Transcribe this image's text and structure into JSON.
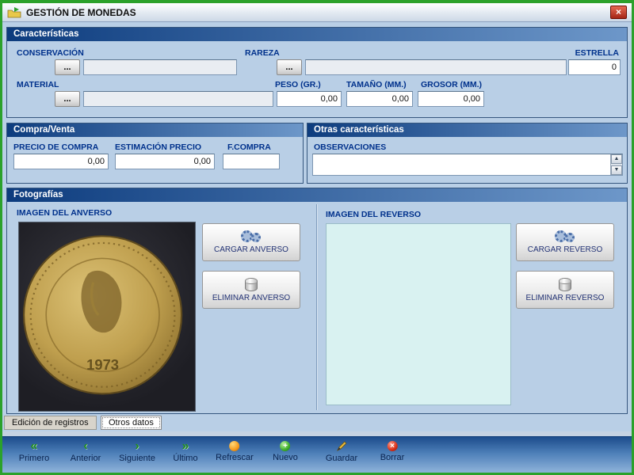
{
  "window": {
    "title": "GESTIÓN DE MONEDAS",
    "close_glyph": "×"
  },
  "icons": {
    "ellipsis": "...",
    "up": "▲",
    "down": "▼"
  },
  "colors": {
    "accent_green": "#2ba12b",
    "header_blue": "#0d3c7e",
    "label_blue": "#00318c",
    "toolbar_blue": "#4d7fb8"
  },
  "caracteristicas": {
    "header": "Características",
    "conservacion_label": "CONSERVACIÓN",
    "conservacion_value": "",
    "rareza_label": "RAREZA",
    "rareza_value": "",
    "estrella_label": "ESTRELLA",
    "estrella_value": "0",
    "material_label": "MATERIAL",
    "material_value": "",
    "peso_label": "PESO (GR.)",
    "peso_value": "0,00",
    "tamano_label": "TAMAÑO (MM.)",
    "tamano_value": "0,00",
    "grosor_label": "GROSOR (MM.)",
    "grosor_value": "0,00"
  },
  "compra_venta": {
    "header": "Compra/Venta",
    "precio_compra_label": "PRECIO DE COMPRA",
    "precio_compra_value": "0,00",
    "estimacion_label": "ESTIMACIÓN PRECIO",
    "estimacion_value": "0,00",
    "fcompra_label": "F.COMPRA",
    "fcompra_value": ""
  },
  "otras": {
    "header": "Otras características",
    "observaciones_label": "OBSERVACIONES",
    "observaciones_value": ""
  },
  "fotografias": {
    "header": "Fotografías",
    "anverso_label": "IMAGEN DEL ANVERSO",
    "cargar_anverso": "CARGAR ANVERSO",
    "eliminar_anverso": "ELIMINAR ANVERSO",
    "coin_year": "1973",
    "reverso_label": "IMAGEN DEL REVERSO",
    "cargar_reverso": "CARGAR REVERSO",
    "eliminar_reverso": "ELIMINAR REVERSO"
  },
  "tabs": [
    {
      "label": "Edición de registros"
    },
    {
      "label": "Otros datos"
    }
  ],
  "toolbar": {
    "buttons": [
      {
        "label": "Primero",
        "glyph": "«"
      },
      {
        "label": "Anterior",
        "glyph": "‹"
      },
      {
        "label": "Siguiente",
        "glyph": "›"
      },
      {
        "label": "Último",
        "glyph": "»"
      },
      {
        "label": "Refrescar",
        "glyph": ""
      },
      {
        "label": "Nuevo",
        "glyph": "+"
      },
      {
        "label": "Guardar",
        "glyph": ""
      },
      {
        "label": "Borrar",
        "glyph": "×"
      }
    ]
  }
}
